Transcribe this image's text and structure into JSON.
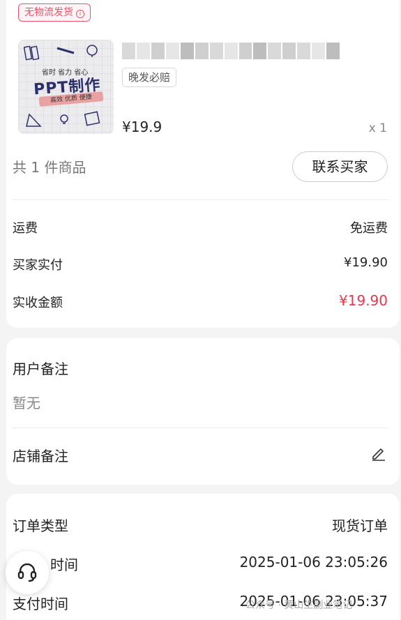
{
  "logistics_tag": {
    "label": "无物流发货",
    "icon": "info-icon"
  },
  "product": {
    "thumbnail": {
      "top_text": "省时 省力 省心",
      "title": "PPT制作",
      "ribbon": "高效 优质 便捷"
    },
    "late_badge": "晚发必赔",
    "price": "¥19.9",
    "quantity": "x 1"
  },
  "summary": {
    "item_count": "共 1 件商品",
    "contact_button": "联系买家"
  },
  "fees": [
    {
      "label": "运费",
      "value": "免运费",
      "highlight": false
    },
    {
      "label": "买家实付",
      "value": "¥19.90",
      "highlight": false
    },
    {
      "label": "实收金额",
      "value": "¥19.90",
      "highlight": true
    }
  ],
  "remarks": {
    "user_label": "用户备注",
    "user_value": "暂无",
    "shop_label": "店铺备注",
    "shop_icon": "edit-icon"
  },
  "order_info": [
    {
      "label": "订单类型",
      "value": "现货订单"
    },
    {
      "label": "时间",
      "value": "2025-01-06 23:05:26"
    },
    {
      "label": "支付时间",
      "value": "2025-01-06 23:05:37"
    }
  ],
  "support_icon": "headset-icon",
  "watermark": "公众号 · 黄山生副业笔记",
  "colors": {
    "accent_red": "#e8374b",
    "tag_red": "#f0506a"
  }
}
